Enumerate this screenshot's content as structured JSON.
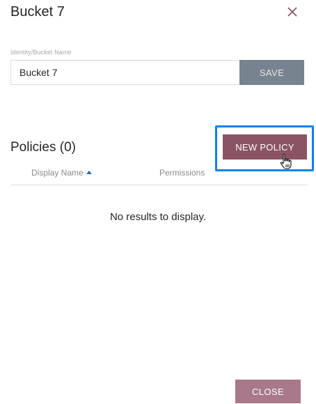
{
  "dialog": {
    "title": "Bucket 7",
    "close_icon": "close-icon"
  },
  "identity": {
    "label": "Identity/Bucket Name",
    "value": "Bucket 7",
    "save_label": "SAVE"
  },
  "policies": {
    "heading": "Policies (0)",
    "new_policy_label": "NEW POLICY",
    "columns": [
      "Display Name",
      "Permissions"
    ],
    "sort_column": "Display Name",
    "sort_direction": "ascending",
    "empty_message": "No results to display."
  },
  "footer": {
    "close_label": "CLOSE"
  },
  "colors": {
    "primary": "#8b5465",
    "close_button": "#a8798a",
    "save_button_disabled": "#77838e",
    "highlight": "#0a82f5",
    "sort_arrow": "#1f6fb5"
  }
}
